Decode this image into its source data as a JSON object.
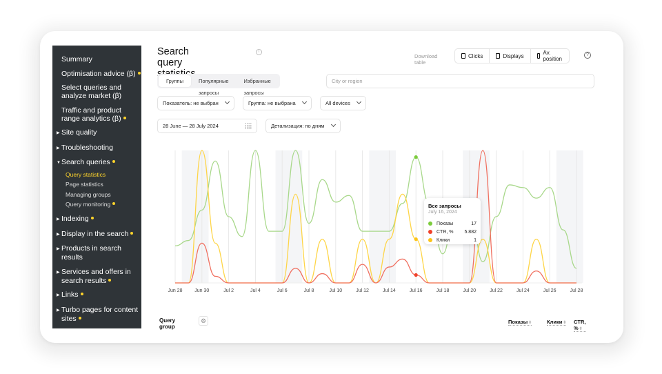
{
  "sidebar": {
    "items": [
      {
        "label": "Summary",
        "caret": false,
        "dot": false
      },
      {
        "label": "Optimisation advice (β)",
        "caret": false,
        "dot": true
      },
      {
        "label": "Select queries and analyze market (β)",
        "caret": false,
        "dot": false
      },
      {
        "label": "Traffic and product range analytics (β)",
        "caret": false,
        "dot": true
      },
      {
        "label": "Site quality",
        "caret": "right",
        "dot": false
      },
      {
        "label": "Troubleshooting",
        "caret": "right",
        "dot": false
      },
      {
        "label": "Search queries",
        "caret": "down",
        "dot": true,
        "sub": [
          {
            "label": "Query statistics",
            "active": true,
            "dot": false
          },
          {
            "label": "Page statistics",
            "active": false,
            "dot": false
          },
          {
            "label": "Managing groups",
            "active": false,
            "dot": false
          },
          {
            "label": "Query monitoring",
            "active": false,
            "dot": true
          }
        ]
      },
      {
        "label": "Indexing",
        "caret": "right",
        "dot": true
      },
      {
        "label": "Display in the search",
        "caret": "right",
        "dot": true
      },
      {
        "label": "Products in search results",
        "caret": "right",
        "dot": false
      },
      {
        "label": "Services and offers in search results",
        "caret": "right",
        "dot": true
      },
      {
        "label": "Links",
        "caret": "right",
        "dot": true
      },
      {
        "label": "Turbo pages for content sites",
        "caret": "right",
        "dot": true
      }
    ]
  },
  "header": {
    "title": "Search query statistics",
    "download_label": "Download table",
    "download_buttons": [
      "Clicks",
      "Displays",
      "Av. position"
    ]
  },
  "tabs": [
    {
      "label": "Группы",
      "active": true
    },
    {
      "label": "Популярные запросы",
      "active": false
    },
    {
      "label": "Избранные запросы",
      "active": false
    }
  ],
  "filters": {
    "city_placeholder": "City or region",
    "indicator": "Показатель: не выбран",
    "group": "Группа: не выбрана",
    "devices": "All devices",
    "date_range": "28 June — 28 July 2024",
    "detail": "Детализация: по дням"
  },
  "colors": {
    "shows": "#a8d88a",
    "ctr": "#f07060",
    "clicks": "#fed547",
    "accent": "#fed42b"
  },
  "chart_data": {
    "type": "line",
    "x": [
      "Jun 28",
      "Jun 29",
      "Jun 30",
      "Jul 1",
      "Jul 2",
      "Jul 3",
      "Jul 4",
      "Jul 5",
      "Jul 6",
      "Jul 7",
      "Jul 8",
      "Jul 9",
      "Jul 10",
      "Jul 11",
      "Jul 12",
      "Jul 13",
      "Jul 14",
      "Jul 15",
      "Jul 16",
      "Jul 17",
      "Jul 18",
      "Jul 19",
      "Jul 20",
      "Jul 21",
      "Jul 22",
      "Jul 23",
      "Jul 24",
      "Jul 25",
      "Jul 26",
      "Jul 27",
      "Jul 28"
    ],
    "tick_labels": [
      "Jun 28",
      "Jun 30",
      "Jul 2",
      "Jul 4",
      "Jul 6",
      "Jul 8",
      "Jul 10",
      "Jul 12",
      "Jul 14",
      "Jul 16",
      "Jul 18",
      "Jul 20",
      "Jul 22",
      "Jul 24",
      "Jul 26",
      "Jul 28"
    ],
    "weekends": [
      [
        "Jun 29",
        "Jun 30"
      ],
      [
        "Jul 6",
        "Jul 7"
      ],
      [
        "Jul 13",
        "Jul 14"
      ],
      [
        "Jul 20",
        "Jul 21"
      ],
      [
        "Jul 27",
        "Jul 28"
      ]
    ],
    "series": [
      {
        "name": "Показы",
        "normalized": [
          0.28,
          0.32,
          0.55,
          0.92,
          0.5,
          0.35,
          1.0,
          0.39,
          0.39,
          1.0,
          0.45,
          0.78,
          0.61,
          0.66,
          0.39,
          0.39,
          0.39,
          0.6,
          0.95,
          0.6,
          0.22,
          0.6,
          0.6,
          0.16,
          0.5,
          0.74,
          0.72,
          0.64,
          0.72,
          0.4,
          0.11
        ]
      },
      {
        "name": "CTR, %",
        "normalized": [
          0.0,
          0.0,
          0.3,
          0.05,
          0.0,
          0.0,
          0.0,
          0.0,
          0.0,
          0.11,
          0.0,
          0.07,
          0.0,
          0.0,
          0.14,
          0.0,
          0.12,
          0.18,
          0.06,
          0.0,
          0.0,
          0.0,
          0.0,
          1.0,
          0.0,
          0.0,
          0.0,
          0.09,
          0.0,
          0.0,
          0.0
        ]
      },
      {
        "name": "Клики",
        "normalized": [
          0.0,
          0.0,
          1.0,
          0.3,
          0.0,
          0.0,
          0.0,
          0.0,
          0.0,
          0.67,
          0.0,
          0.33,
          0.0,
          0.0,
          0.33,
          0.0,
          0.33,
          0.67,
          0.33,
          0.0,
          0.0,
          0.0,
          0.0,
          0.33,
          0.0,
          0.0,
          0.0,
          0.33,
          0.0,
          0.0,
          0.0
        ]
      }
    ],
    "highlight_index": 18,
    "tooltip": {
      "title": "Все запросы",
      "date": "July 16, 2024",
      "rows": [
        {
          "name": "Показы",
          "value": "17"
        },
        {
          "name": "CTR, %",
          "value": "5.882"
        },
        {
          "name": "Клики",
          "value": "1"
        }
      ]
    },
    "grid": true
  },
  "table": {
    "group_label": "Query group",
    "columns": [
      "Показы",
      "Клики",
      "CTR, %"
    ]
  }
}
